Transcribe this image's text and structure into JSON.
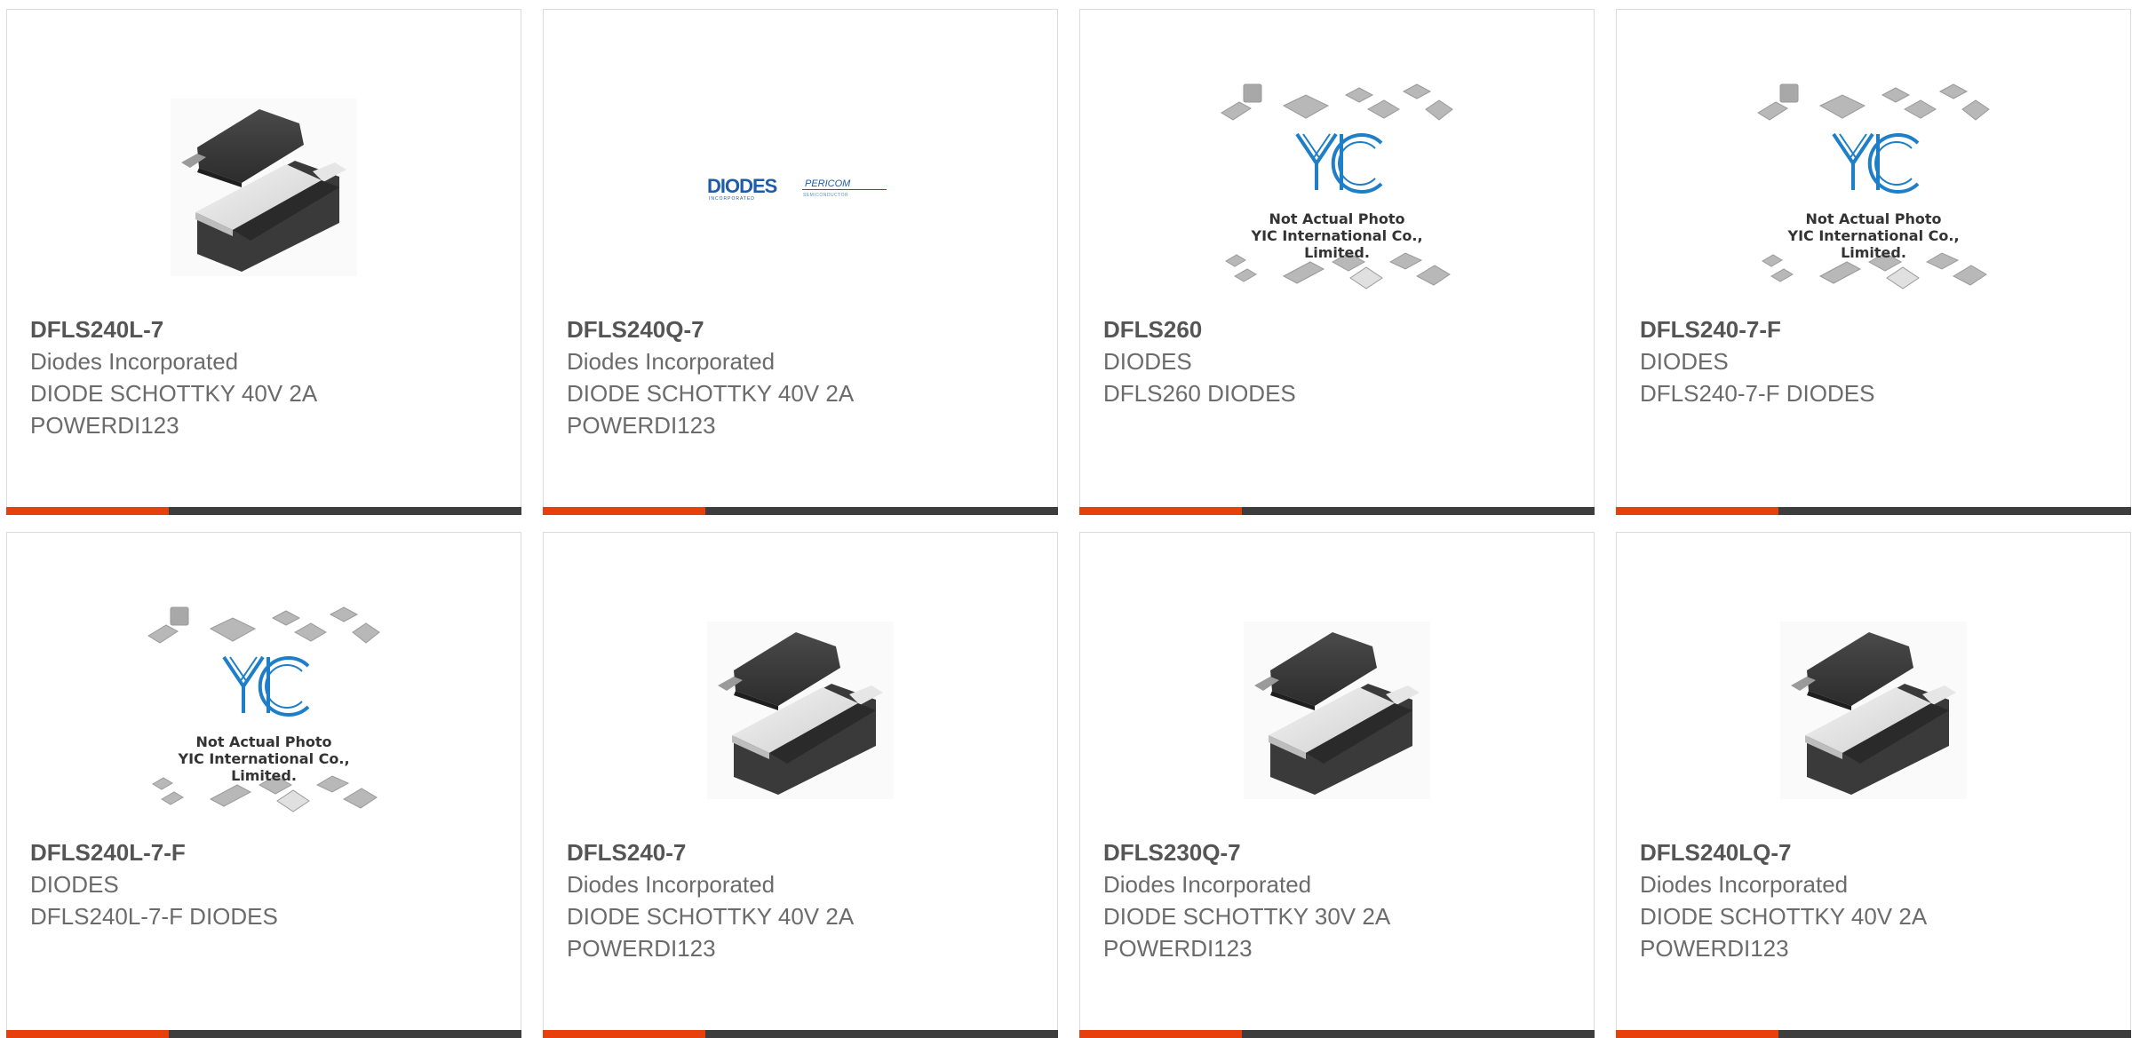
{
  "products": [
    {
      "part": "DFLS240L-7",
      "maker": "Diodes Incorporated",
      "desc": [
        "DIODE SCHOTTKY 40V 2A",
        "POWERDI123"
      ],
      "image": "diode-package"
    },
    {
      "part": "DFLS240Q-7",
      "maker": "Diodes Incorporated",
      "desc": [
        "DIODE SCHOTTKY 40V 2A",
        "POWERDI123"
      ],
      "image": "diodes-pericom-logo"
    },
    {
      "part": "DFLS260",
      "maker": "DIODES",
      "desc": [
        "DFLS260 DIODES"
      ],
      "image": "yic-placeholder"
    },
    {
      "part": "DFLS240-7-F",
      "maker": "DIODES",
      "desc": [
        "DFLS240-7-F DIODES"
      ],
      "image": "yic-placeholder"
    },
    {
      "part": "DFLS240L-7-F",
      "maker": "DIODES",
      "desc": [
        "DFLS240L-7-F DIODES"
      ],
      "image": "yic-placeholder"
    },
    {
      "part": "DFLS240-7",
      "maker": "Diodes Incorporated",
      "desc": [
        "DIODE SCHOTTKY 40V 2A",
        "POWERDI123"
      ],
      "image": "diode-package"
    },
    {
      "part": "DFLS230Q-7",
      "maker": "Diodes Incorporated",
      "desc": [
        "DIODE SCHOTTKY 30V 2A",
        "POWERDI123"
      ],
      "image": "diode-package"
    },
    {
      "part": "DFLS240LQ-7",
      "maker": "Diodes Incorporated",
      "desc": [
        "DIODE SCHOTTKY 40V 2A",
        "POWERDI123"
      ],
      "image": "diode-package"
    }
  ],
  "placeholder": {
    "brand": "YIC",
    "line1": "Not Actual Photo",
    "line2": "YIC International Co., Limited."
  },
  "logos": {
    "diodes": "DIODES",
    "diodes_sub": "INCORPORATED",
    "pericom": "PERICOM",
    "pericom_sub": "SEMICONDUCTOR"
  },
  "colors": {
    "accent": "#e8400c",
    "bar": "#3d3d3d",
    "border": "#dcdcdc",
    "yic_blue": "#1e7fc8"
  }
}
